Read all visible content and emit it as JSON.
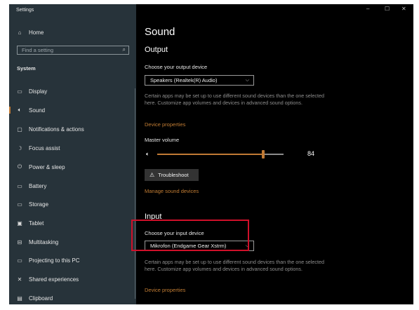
{
  "window": {
    "title": "Settings",
    "controls": {
      "minimize": "–",
      "maximize": "☐",
      "close": "✕"
    }
  },
  "sidebar": {
    "home": {
      "label": "Home",
      "icon": "home-icon"
    },
    "search": {
      "placeholder": "Find a setting",
      "icon": "search-icon"
    },
    "section": "System",
    "items": [
      {
        "label": "Display",
        "icon": "monitor-icon",
        "glyph": "▭"
      },
      {
        "label": "Sound",
        "icon": "speaker-icon",
        "glyph": "◁)",
        "active": true
      },
      {
        "label": "Notifications & actions",
        "icon": "notification-icon",
        "glyph": "▢"
      },
      {
        "label": "Focus assist",
        "icon": "moon-icon",
        "glyph": "☽"
      },
      {
        "label": "Power & sleep",
        "icon": "power-icon",
        "glyph": "⏻"
      },
      {
        "label": "Battery",
        "icon": "battery-icon",
        "glyph": "▭"
      },
      {
        "label": "Storage",
        "icon": "storage-icon",
        "glyph": "▭"
      },
      {
        "label": "Tablet",
        "icon": "tablet-icon",
        "glyph": "▣"
      },
      {
        "label": "Multitasking",
        "icon": "multitasking-icon",
        "glyph": "⊟"
      },
      {
        "label": "Projecting to this PC",
        "icon": "projector-icon",
        "glyph": "▭"
      },
      {
        "label": "Shared experiences",
        "icon": "shared-icon",
        "glyph": "✕"
      },
      {
        "label": "Clipboard",
        "icon": "clipboard-icon",
        "glyph": "▤"
      }
    ]
  },
  "main": {
    "title": "Sound",
    "output": {
      "heading": "Output",
      "device_label": "Choose your output device",
      "device_value": "Speakers (Realtek(R) Audio)",
      "description": "Certain apps may be set up to use different sound devices than the one selected here. Customize app volumes and devices in advanced sound options.",
      "device_properties_link": "Device properties",
      "master_volume_label": "Master volume",
      "volume_value": "84",
      "volume_fraction": 0.84,
      "troubleshoot_label": "Troubleshoot",
      "manage_link": "Manage sound devices"
    },
    "input": {
      "heading": "Input",
      "device_label": "Choose your input device",
      "device_value": "Mikrofon (Endgame Gear Xstrm)",
      "description": "Certain apps may be set up to use different sound devices than the one selected here. Customize app volumes and devices in advanced sound options.",
      "device_properties_link": "Device properties"
    }
  },
  "colors": {
    "accent": "#c07a35",
    "sidebar_bg": "#27333a",
    "content_bg": "#000000",
    "highlight": "#d0102a"
  }
}
